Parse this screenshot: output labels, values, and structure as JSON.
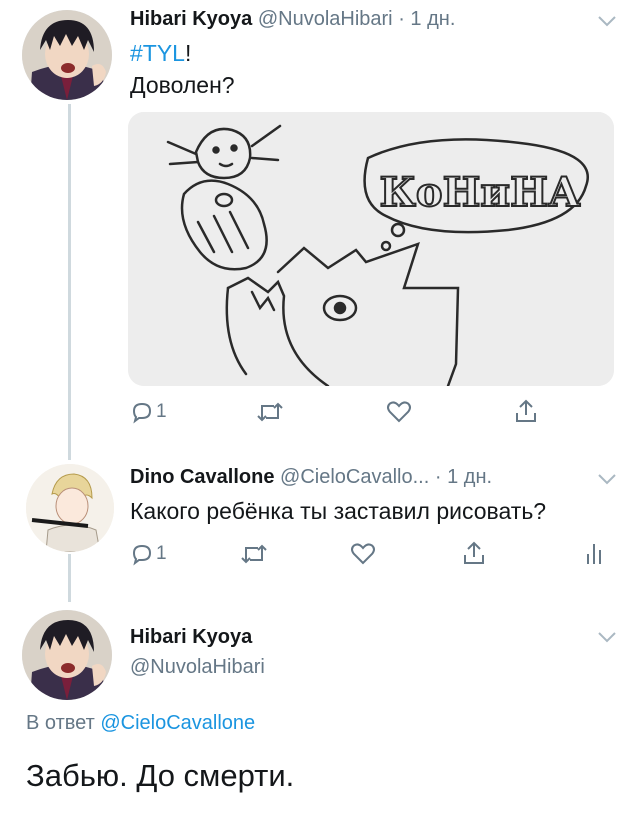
{
  "tweet1": {
    "name": "Hibari Kyoya",
    "handle": "@NuvolaHibari",
    "separator": "·",
    "time": "1 дн.",
    "hashtag": "#TYL",
    "hashtag_suffix": "!",
    "text": "Доволен?",
    "image_caption": "КоНиНА",
    "reply_count": "1",
    "colors": {
      "link": "#1b95e0",
      "muted": "#657786"
    }
  },
  "tweet2": {
    "name": "Dino Cavallone",
    "handle": "@CieloCavallo...",
    "separator": "·",
    "time": "1 дн.",
    "text": "Какого ребёнка ты заставил рисовать?",
    "reply_count": "1"
  },
  "tweet3": {
    "name": "Hibari Kyoya",
    "handle": "@NuvolaHibari",
    "reply_prefix": "В ответ",
    "reply_to": "@CieloCavallone",
    "text": "Забью. До смерти."
  },
  "icons": [
    "chevron-down-icon",
    "reply-icon",
    "retweet-icon",
    "like-icon",
    "share-icon",
    "analytics-icon"
  ]
}
